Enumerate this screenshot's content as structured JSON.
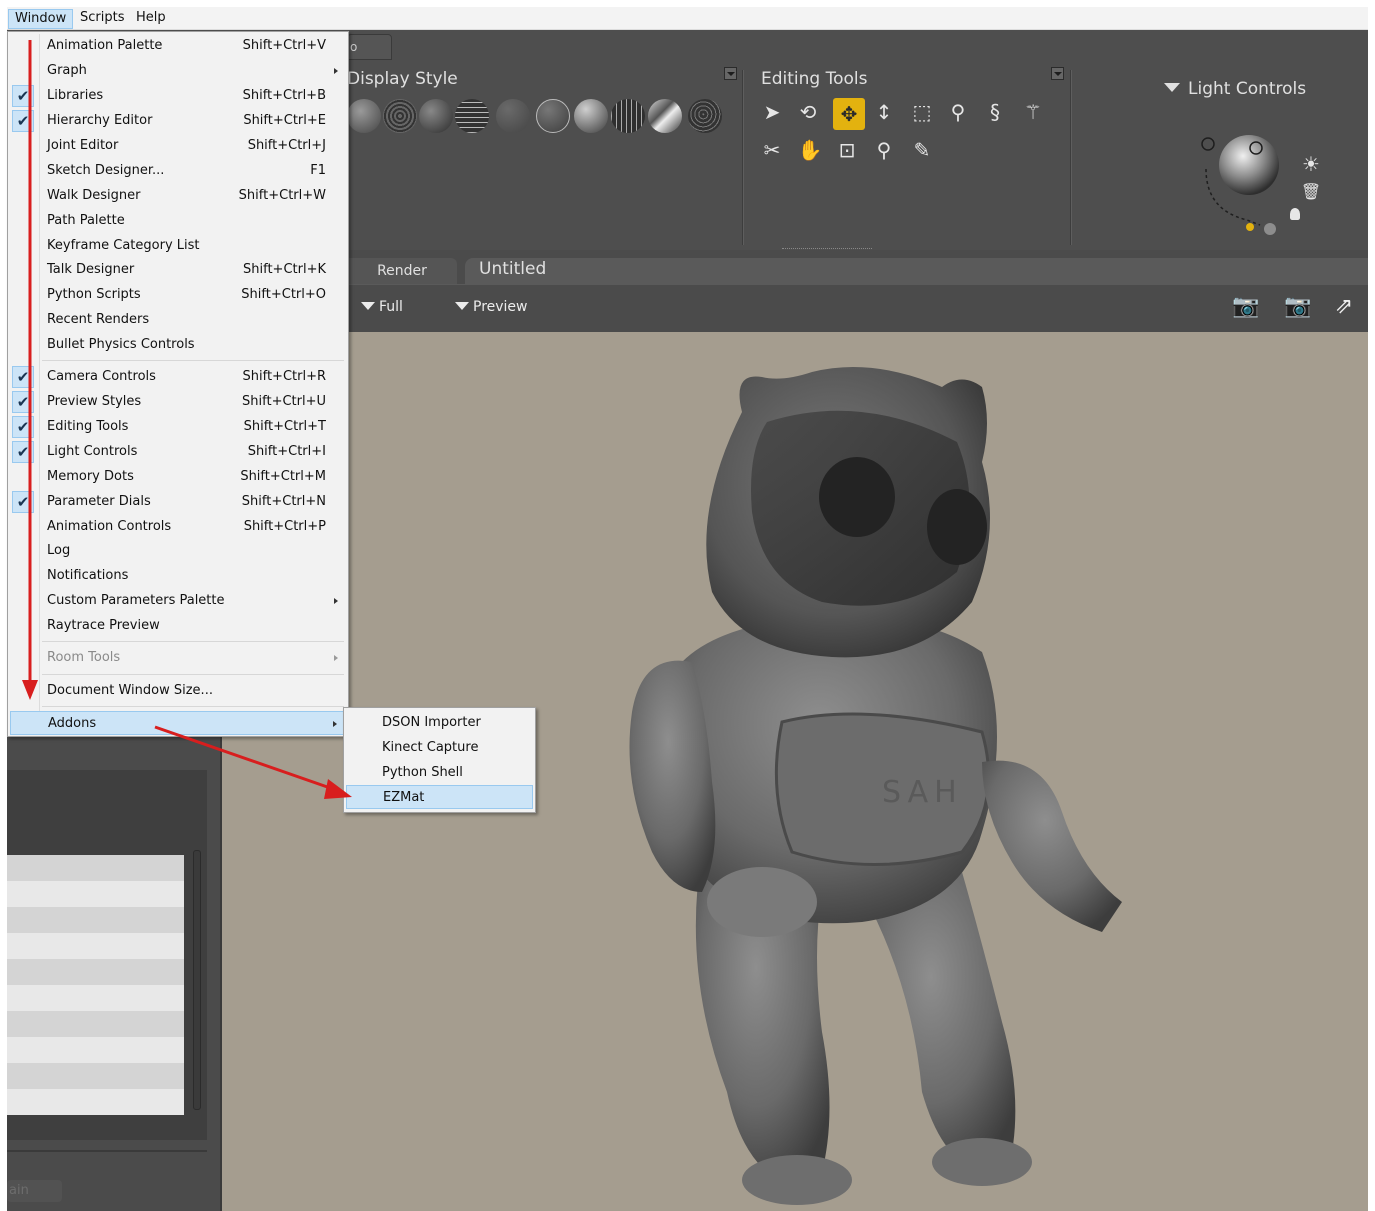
{
  "menubar": {
    "items": [
      "Window",
      "Scripts",
      "Help"
    ]
  },
  "toolbars": {
    "display_style_title": "Display Style",
    "editing_tools_title": "Editing Tools",
    "light_controls_title": "Light Controls",
    "partial_tab_glyph": "o"
  },
  "tabs": {
    "render": "Render",
    "document": "Untitled"
  },
  "viewport_toolbar": {
    "full_label": "Full",
    "preview_label": "Preview"
  },
  "left_dock": {
    "button_fragment": "ain"
  },
  "viewport": {
    "figure_chest_text": "SAH"
  },
  "window_menu": {
    "items": [
      {
        "label": "Animation Palette",
        "shortcut": "Shift+Ctrl+V",
        "checked": false
      },
      {
        "label": "Graph",
        "shortcut": "",
        "submenu": true
      },
      {
        "label": "Libraries",
        "shortcut": "Shift+Ctrl+B",
        "checked": true
      },
      {
        "label": "Hierarchy Editor",
        "shortcut": "Shift+Ctrl+E",
        "checked": true
      },
      {
        "label": "Joint Editor",
        "shortcut": "Shift+Ctrl+J"
      },
      {
        "label": "Sketch Designer...",
        "shortcut": "F1"
      },
      {
        "label": "Walk Designer",
        "shortcut": "Shift+Ctrl+W"
      },
      {
        "label": "Path Palette",
        "shortcut": ""
      },
      {
        "label": "Keyframe Category List",
        "shortcut": ""
      },
      {
        "label": "Talk Designer",
        "shortcut": "Shift+Ctrl+K"
      },
      {
        "label": "Python Scripts",
        "shortcut": "Shift+Ctrl+O"
      },
      {
        "label": "Recent Renders",
        "shortcut": ""
      },
      {
        "label": "Bullet Physics Controls",
        "shortcut": ""
      },
      {
        "label": "Camera Controls",
        "shortcut": "Shift+Ctrl+R",
        "checked": true
      },
      {
        "label": "Preview Styles",
        "shortcut": "Shift+Ctrl+U",
        "checked": true
      },
      {
        "label": "Editing Tools",
        "shortcut": "Shift+Ctrl+T",
        "checked": true
      },
      {
        "label": "Light Controls",
        "shortcut": "Shift+Ctrl+I",
        "checked": true
      },
      {
        "label": "Memory Dots",
        "shortcut": "Shift+Ctrl+M"
      },
      {
        "label": "Parameter Dials",
        "shortcut": "Shift+Ctrl+N",
        "checked": true
      },
      {
        "label": "Animation Controls",
        "shortcut": "Shift+Ctrl+P"
      },
      {
        "label": "Log",
        "shortcut": ""
      },
      {
        "label": "Notifications",
        "shortcut": ""
      },
      {
        "label": "Custom Parameters Palette",
        "shortcut": "",
        "submenu": true
      },
      {
        "label": "Raytrace Preview",
        "shortcut": ""
      },
      {
        "label": "Room Tools",
        "shortcut": "",
        "submenu": true,
        "disabled": true
      },
      {
        "label": "Document Window Size...",
        "shortcut": ""
      },
      {
        "label": "Addons",
        "shortcut": "",
        "submenu": true,
        "highlighted": true
      }
    ]
  },
  "addons_menu": {
    "items": [
      {
        "label": "DSON Importer"
      },
      {
        "label": "Kinect Capture"
      },
      {
        "label": "Python Shell"
      },
      {
        "label": "EZMat",
        "highlighted": true
      }
    ]
  },
  "colors": {
    "menu_bg": "#f2f2f2",
    "highlight_bg": "#cce4f7",
    "highlight_border": "#99c9ef",
    "app_bg": "#4b4b4b",
    "viewport_bg": "#a59d8f",
    "active_tool": "#e3b20f",
    "annotation_arrow": "#d81e1e"
  },
  "icons": {
    "editing_tools": [
      "select-arrow-icon",
      "rotate-icon",
      "translate-icon",
      "scale-vertical-icon",
      "taper-icon",
      "twist-icon",
      "chain-break-icon",
      "direct-manipulation-icon",
      "color-icon",
      "grab-icon",
      "morph-icon",
      "zoom-icon",
      "eraser-icon"
    ],
    "viewport": [
      "camera-icon",
      "camera-dim-icon",
      "export-icon"
    ],
    "light": [
      "sun-icon",
      "trash-icon",
      "bulb-icon"
    ]
  }
}
